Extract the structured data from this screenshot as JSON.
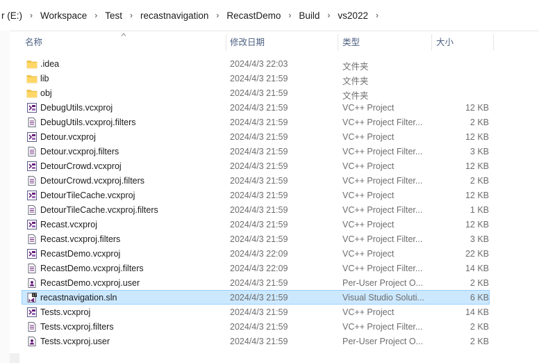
{
  "breadcrumb": {
    "items": [
      "r (E:)",
      "Workspace",
      "Test",
      "recastnavigation",
      "RecastDemo",
      "Build",
      "vs2022"
    ],
    "separator": "›"
  },
  "columns": {
    "name": "名称",
    "date": "修改日期",
    "type": "类型",
    "size": "大小"
  },
  "colors": {
    "selected_bg": "#cce8ff",
    "selected_border": "#99d1ff",
    "folder": "#f5c542",
    "vs_purple": "#68217a"
  },
  "files": [
    {
      "name": ".idea",
      "date": "2024/4/3 22:03",
      "type": "文件夹",
      "size": "",
      "icon": "folder-icon"
    },
    {
      "name": "lib",
      "date": "2024/4/3 21:59",
      "type": "文件夹",
      "size": "",
      "icon": "folder-icon"
    },
    {
      "name": "obj",
      "date": "2024/4/3 21:59",
      "type": "文件夹",
      "size": "",
      "icon": "folder-icon"
    },
    {
      "name": "DebugUtils.vcxproj",
      "date": "2024/4/3 21:59",
      "type": "VC++ Project",
      "size": "12 KB",
      "icon": "vcxproj-icon"
    },
    {
      "name": "DebugUtils.vcxproj.filters",
      "date": "2024/4/3 21:59",
      "type": "VC++ Project Filter...",
      "size": "2 KB",
      "icon": "filters-file-icon"
    },
    {
      "name": "Detour.vcxproj",
      "date": "2024/4/3 21:59",
      "type": "VC++ Project",
      "size": "12 KB",
      "icon": "vcxproj-icon"
    },
    {
      "name": "Detour.vcxproj.filters",
      "date": "2024/4/3 21:59",
      "type": "VC++ Project Filter...",
      "size": "3 KB",
      "icon": "filters-file-icon"
    },
    {
      "name": "DetourCrowd.vcxproj",
      "date": "2024/4/3 21:59",
      "type": "VC++ Project",
      "size": "12 KB",
      "icon": "vcxproj-icon"
    },
    {
      "name": "DetourCrowd.vcxproj.filters",
      "date": "2024/4/3 21:59",
      "type": "VC++ Project Filter...",
      "size": "2 KB",
      "icon": "filters-file-icon"
    },
    {
      "name": "DetourTileCache.vcxproj",
      "date": "2024/4/3 21:59",
      "type": "VC++ Project",
      "size": "12 KB",
      "icon": "vcxproj-icon"
    },
    {
      "name": "DetourTileCache.vcxproj.filters",
      "date": "2024/4/3 21:59",
      "type": "VC++ Project Filter...",
      "size": "1 KB",
      "icon": "filters-file-icon"
    },
    {
      "name": "Recast.vcxproj",
      "date": "2024/4/3 21:59",
      "type": "VC++ Project",
      "size": "12 KB",
      "icon": "vcxproj-icon"
    },
    {
      "name": "Recast.vcxproj.filters",
      "date": "2024/4/3 21:59",
      "type": "VC++ Project Filter...",
      "size": "3 KB",
      "icon": "filters-file-icon"
    },
    {
      "name": "RecastDemo.vcxproj",
      "date": "2024/4/3 22:09",
      "type": "VC++ Project",
      "size": "22 KB",
      "icon": "vcxproj-icon"
    },
    {
      "name": "RecastDemo.vcxproj.filters",
      "date": "2024/4/3 22:09",
      "type": "VC++ Project Filter...",
      "size": "14 KB",
      "icon": "filters-file-icon"
    },
    {
      "name": "RecastDemo.vcxproj.user",
      "date": "2024/4/3 21:59",
      "type": "Per-User Project O...",
      "size": "2 KB",
      "icon": "user-file-icon"
    },
    {
      "name": "recastnavigation.sln",
      "date": "2024/4/3 21:59",
      "type": "Visual Studio Soluti...",
      "size": "6 KB",
      "icon": "sln-icon",
      "selected": true
    },
    {
      "name": "Tests.vcxproj",
      "date": "2024/4/3 21:59",
      "type": "VC++ Project",
      "size": "14 KB",
      "icon": "vcxproj-icon"
    },
    {
      "name": "Tests.vcxproj.filters",
      "date": "2024/4/3 21:59",
      "type": "VC++ Project Filter...",
      "size": "2 KB",
      "icon": "filters-file-icon"
    },
    {
      "name": "Tests.vcxproj.user",
      "date": "2024/4/3 21:59",
      "type": "Per-User Project O...",
      "size": "2 KB",
      "icon": "user-file-icon"
    }
  ]
}
